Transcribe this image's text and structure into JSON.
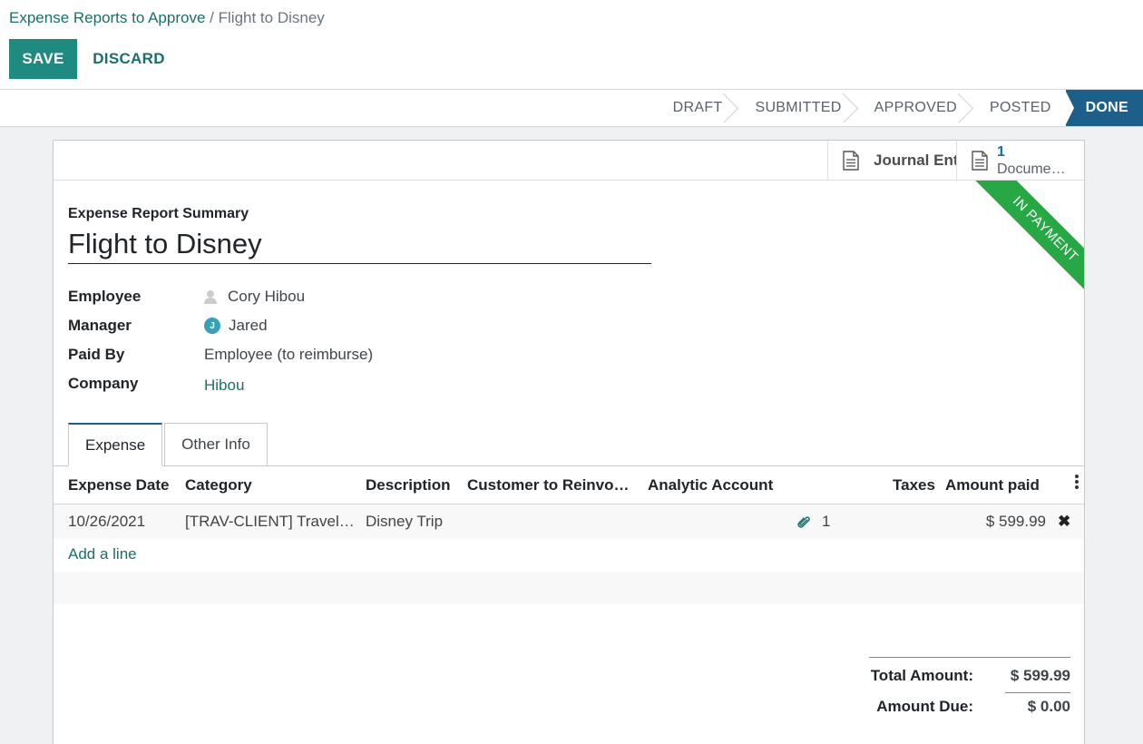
{
  "breadcrumb": {
    "parent": "Expense Reports to Approve",
    "separator": "/",
    "current": "Flight to Disney"
  },
  "toolbar": {
    "save_label": "SAVE",
    "discard_label": "DISCARD"
  },
  "status_stages": [
    "DRAFT",
    "SUBMITTED",
    "APPROVED",
    "POSTED",
    "DONE"
  ],
  "status_active": "DONE",
  "smart_buttons": {
    "journal_label": "Journal Ent",
    "documents_count": "1",
    "documents_label": "Docume…"
  },
  "ribbon": "IN PAYMENT",
  "form": {
    "summary_label": "Expense Report Summary",
    "title": "Flight to Disney",
    "fields": {
      "employee_label": "Employee",
      "employee_value": "Cory Hibou",
      "manager_label": "Manager",
      "manager_avatar": "J",
      "manager_value": "Jared",
      "paid_by_label": "Paid By",
      "paid_by_value": "Employee (to reimburse)",
      "company_label": "Company",
      "company_value": "Hibou"
    }
  },
  "tabs": [
    "Expense",
    "Other Info"
  ],
  "table": {
    "columns": [
      "Expense Date",
      "Category",
      "Description",
      "Customer to Reinvoi…",
      "Analytic Account",
      "Taxes",
      "Amount paid"
    ],
    "rows": [
      {
        "date": "10/26/2021",
        "category": "[TRAV-CLIENT] Travel…",
        "description": "Disney Trip",
        "attachments": "1",
        "amount": "$ 599.99"
      }
    ],
    "add_line": "Add a line"
  },
  "totals": {
    "total_label": "Total Amount:",
    "total_value": "$ 599.99",
    "due_label": "Amount Due:",
    "due_value": "$ 0.00"
  },
  "colors": {
    "primary": "#1f8a80",
    "link": "#1a6f6b",
    "status_active": "#1b5f8a",
    "ribbon": "#28a745"
  }
}
